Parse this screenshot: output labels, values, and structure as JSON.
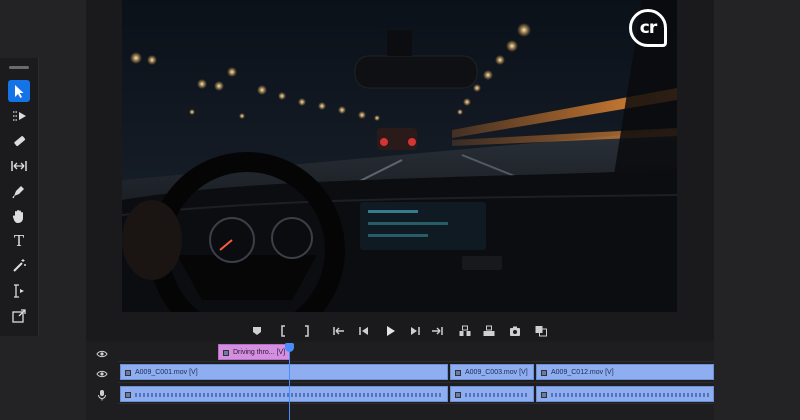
{
  "brand": {
    "logo_text": "cr"
  },
  "tools": {
    "items": [
      {
        "id": "selection",
        "icon": "arrow-select-icon",
        "active": true
      },
      {
        "id": "track-select",
        "icon": "track-select-icon",
        "active": false
      },
      {
        "id": "razor",
        "icon": "razor-icon",
        "active": false
      },
      {
        "id": "ripple",
        "icon": "ripple-edit-icon",
        "active": false
      },
      {
        "id": "pen",
        "icon": "pen-icon",
        "active": false
      },
      {
        "id": "hand",
        "icon": "hand-icon",
        "active": false
      },
      {
        "id": "type",
        "icon": "type-icon",
        "active": false
      },
      {
        "id": "magic",
        "icon": "magic-wand-icon",
        "active": false
      },
      {
        "id": "slip",
        "icon": "slip-icon",
        "active": false
      },
      {
        "id": "export",
        "icon": "export-frame-icon",
        "active": false
      }
    ],
    "type_glyph": "T"
  },
  "transport": {
    "buttons": [
      "marker",
      "mark-in",
      "mark-out",
      "go-to-in",
      "step-back",
      "play",
      "step-forward",
      "go-to-out",
      "insert",
      "overwrite",
      "export-frame",
      "compare"
    ]
  },
  "timeline": {
    "title_track": {
      "clips": [
        {
          "label": "Driving thro... [V]"
        }
      ]
    },
    "video_track": {
      "clips": [
        {
          "label": "A009_C001.mov [V]"
        },
        {
          "label": "A009_C003.mov [V]"
        },
        {
          "label": "A009_C012.mov [V]"
        }
      ]
    }
  },
  "colors": {
    "accent": "#1473e6",
    "title_clip": "#d58fe0",
    "video_clip": "#8eaef0"
  }
}
